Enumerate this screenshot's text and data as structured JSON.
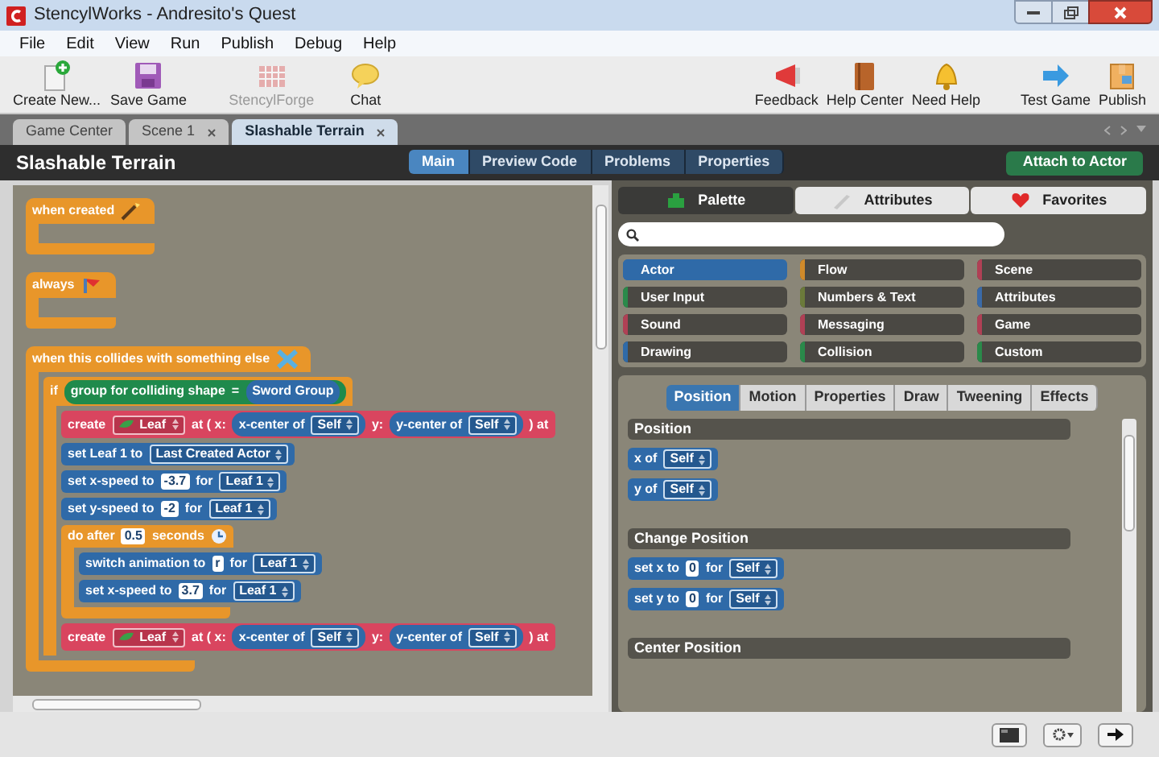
{
  "window": {
    "title": "StencylWorks - Andresito's Quest"
  },
  "menu": [
    "File",
    "Edit",
    "View",
    "Run",
    "Publish",
    "Debug",
    "Help"
  ],
  "toolbar_left": [
    {
      "label": "Create New...",
      "disabled": false
    },
    {
      "label": "Save Game",
      "disabled": false
    },
    {
      "label": "StencylForge",
      "disabled": true
    },
    {
      "label": "Chat",
      "disabled": false
    }
  ],
  "toolbar_right": [
    {
      "label": "Feedback"
    },
    {
      "label": "Help Center"
    },
    {
      "label": "Need Help"
    },
    {
      "label": "Test Game"
    },
    {
      "label": "Publish"
    }
  ],
  "doc_tabs": [
    {
      "label": "Game Center",
      "selected": false,
      "closable": false
    },
    {
      "label": "Scene 1",
      "selected": false,
      "closable": true
    },
    {
      "label": "Slashable Terrain",
      "selected": true,
      "closable": true
    }
  ],
  "editor": {
    "title": "Slashable Terrain",
    "attach_button": "Attach to Actor",
    "mode_tabs": [
      {
        "label": "Main",
        "selected": true
      },
      {
        "label": "Preview Code",
        "selected": false
      },
      {
        "label": "Problems",
        "selected": false
      },
      {
        "label": "Properties",
        "selected": false
      }
    ]
  },
  "scripts": [
    {
      "kind": "hat",
      "color": "#e8962a",
      "parts": [
        {
          "kind": "text",
          "text": "when created"
        }
      ]
    },
    {
      "kind": "hat",
      "color": "#e8962a",
      "parts": [
        {
          "kind": "text",
          "text": "always"
        }
      ]
    },
    {
      "kind": "hat",
      "color": "#e8962a",
      "parts": [
        {
          "kind": "text",
          "text": "when this collides with something else"
        }
      ],
      "children": [
        {
          "kind": "if",
          "color": "#e8962a",
          "parts": [
            {
              "kind": "text",
              "text": "if"
            },
            {
              "kind": "reporter",
              "color": "#1f8a4c",
              "parts": [
                {
                  "kind": "text",
                  "text": "group for colliding shape"
                },
                {
                  "kind": "text",
                  "text": "="
                },
                {
                  "kind": "reporter",
                  "color": "#2f6aa8",
                  "parts": [
                    {
                      "kind": "text",
                      "text": "Sword Group"
                    }
                  ]
                }
              ]
            }
          ],
          "children": [
            {
              "kind": "statement",
              "color": "#d9455f",
              "parts": [
                {
                  "kind": "text",
                  "text": "create"
                },
                {
                  "kind": "actor",
                  "text": "Leaf"
                },
                {
                  "kind": "text",
                  "text": "at ( x:"
                },
                {
                  "kind": "reporter",
                  "color": "#2f6aa8",
                  "parts": [
                    {
                      "kind": "text",
                      "text": "x-center of"
                    },
                    {
                      "kind": "dropdown",
                      "text": "Self"
                    }
                  ]
                },
                {
                  "kind": "text",
                  "text": "y:"
                },
                {
                  "kind": "reporter",
                  "color": "#2f6aa8",
                  "parts": [
                    {
                      "kind": "text",
                      "text": "y-center of"
                    },
                    {
                      "kind": "dropdown",
                      "text": "Self"
                    }
                  ]
                },
                {
                  "kind": "text",
                  "text": ") at"
                }
              ]
            },
            {
              "kind": "statement",
              "color": "#2f6aa8",
              "parts": [
                {
                  "kind": "text",
                  "text": "set Leaf 1 to"
                },
                {
                  "kind": "dropdown",
                  "text": "Last Created Actor"
                }
              ]
            },
            {
              "kind": "statement",
              "color": "#2f6aa8",
              "parts": [
                {
                  "kind": "text",
                  "text": "set x-speed to"
                },
                {
                  "kind": "number",
                  "text": "-3.7"
                },
                {
                  "kind": "text",
                  "text": "for"
                },
                {
                  "kind": "dropdown",
                  "text": "Leaf 1"
                }
              ]
            },
            {
              "kind": "statement",
              "color": "#2f6aa8",
              "parts": [
                {
                  "kind": "text",
                  "text": "set y-speed to"
                },
                {
                  "kind": "number",
                  "text": "-2"
                },
                {
                  "kind": "text",
                  "text": "for"
                },
                {
                  "kind": "dropdown",
                  "text": "Leaf 1"
                }
              ]
            },
            {
              "kind": "wrapper",
              "color": "#e8962a",
              "parts": [
                {
                  "kind": "text",
                  "text": "do after"
                },
                {
                  "kind": "number",
                  "text": "0.5"
                },
                {
                  "kind": "text",
                  "text": "seconds"
                }
              ],
              "children": [
                {
                  "kind": "statement",
                  "color": "#2f6aa8",
                  "parts": [
                    {
                      "kind": "text",
                      "text": "switch animation to"
                    },
                    {
                      "kind": "number",
                      "text": "r"
                    },
                    {
                      "kind": "text",
                      "text": "for"
                    },
                    {
                      "kind": "dropdown",
                      "text": "Leaf 1"
                    }
                  ]
                },
                {
                  "kind": "statement",
                  "color": "#2f6aa8",
                  "parts": [
                    {
                      "kind": "text",
                      "text": "set x-speed to"
                    },
                    {
                      "kind": "number",
                      "text": "3.7"
                    },
                    {
                      "kind": "text",
                      "text": "for"
                    },
                    {
                      "kind": "dropdown",
                      "text": "Leaf 1"
                    }
                  ]
                }
              ]
            },
            {
              "kind": "statement",
              "color": "#d9455f",
              "parts": [
                {
                  "kind": "text",
                  "text": "create"
                },
                {
                  "kind": "actor",
                  "text": "Leaf"
                },
                {
                  "kind": "text",
                  "text": "at ( x:"
                },
                {
                  "kind": "reporter",
                  "color": "#2f6aa8",
                  "parts": [
                    {
                      "kind": "text",
                      "text": "x-center of"
                    },
                    {
                      "kind": "dropdown",
                      "text": "Self"
                    }
                  ]
                },
                {
                  "kind": "text",
                  "text": "y:"
                },
                {
                  "kind": "reporter",
                  "color": "#2f6aa8",
                  "parts": [
                    {
                      "kind": "text",
                      "text": "y-center of"
                    },
                    {
                      "kind": "dropdown",
                      "text": "Self"
                    }
                  ]
                },
                {
                  "kind": "text",
                  "text": ") at"
                }
              ]
            }
          ]
        }
      ]
    }
  ],
  "palette": {
    "tabs": [
      {
        "label": "Palette",
        "selected": true
      },
      {
        "label": "Attributes",
        "selected": false
      },
      {
        "label": "Favorites",
        "selected": false
      }
    ],
    "categories": [
      {
        "label": "Actor",
        "color": "#2f6aa8",
        "selected": true
      },
      {
        "label": "Flow",
        "color": "#d08a2a",
        "selected": false
      },
      {
        "label": "Scene",
        "color": "#b04055",
        "selected": false
      },
      {
        "label": "User Input",
        "color": "#2a8a4a",
        "selected": false
      },
      {
        "label": "Numbers & Text",
        "color": "#6b7a3a",
        "selected": false
      },
      {
        "label": "Attributes",
        "color": "#3a6aa8",
        "selected": false
      },
      {
        "label": "Sound",
        "color": "#b04055",
        "selected": false
      },
      {
        "label": "Messaging",
        "color": "#b04055",
        "selected": false
      },
      {
        "label": "Game",
        "color": "#b04055",
        "selected": false
      },
      {
        "label": "Drawing",
        "color": "#2f6aa8",
        "selected": false
      },
      {
        "label": "Collision",
        "color": "#2a8a4a",
        "selected": false
      },
      {
        "label": "Custom",
        "color": "#2a8a4a",
        "selected": false
      }
    ],
    "sub_tabs": [
      {
        "label": "Position",
        "selected": true
      },
      {
        "label": "Motion",
        "selected": false
      },
      {
        "label": "Properties",
        "selected": false
      },
      {
        "label": "Draw",
        "selected": false
      },
      {
        "label": "Tweening",
        "selected": false
      },
      {
        "label": "Effects",
        "selected": false
      }
    ],
    "sections": [
      {
        "title": "Position",
        "blocks": [
          {
            "kind": "statement",
            "color": "#2f6aa8",
            "parts": [
              {
                "kind": "text",
                "text": "x of"
              },
              {
                "kind": "dropdown",
                "text": "Self"
              }
            ]
          },
          {
            "kind": "statement",
            "color": "#2f6aa8",
            "parts": [
              {
                "kind": "text",
                "text": "y of"
              },
              {
                "kind": "dropdown",
                "text": "Self"
              }
            ]
          }
        ]
      },
      {
        "title": "Change Position",
        "blocks": [
          {
            "kind": "statement",
            "color": "#2f6aa8",
            "parts": [
              {
                "kind": "text",
                "text": "set x to"
              },
              {
                "kind": "number",
                "text": "0"
              },
              {
                "kind": "text",
                "text": "for"
              },
              {
                "kind": "dropdown",
                "text": "Self"
              }
            ]
          },
          {
            "kind": "statement",
            "color": "#2f6aa8",
            "parts": [
              {
                "kind": "text",
                "text": "set y to"
              },
              {
                "kind": "number",
                "text": "0"
              },
              {
                "kind": "text",
                "text": "for"
              },
              {
                "kind": "dropdown",
                "text": "Self"
              }
            ]
          }
        ]
      },
      {
        "title": "Center Position"
      }
    ]
  }
}
